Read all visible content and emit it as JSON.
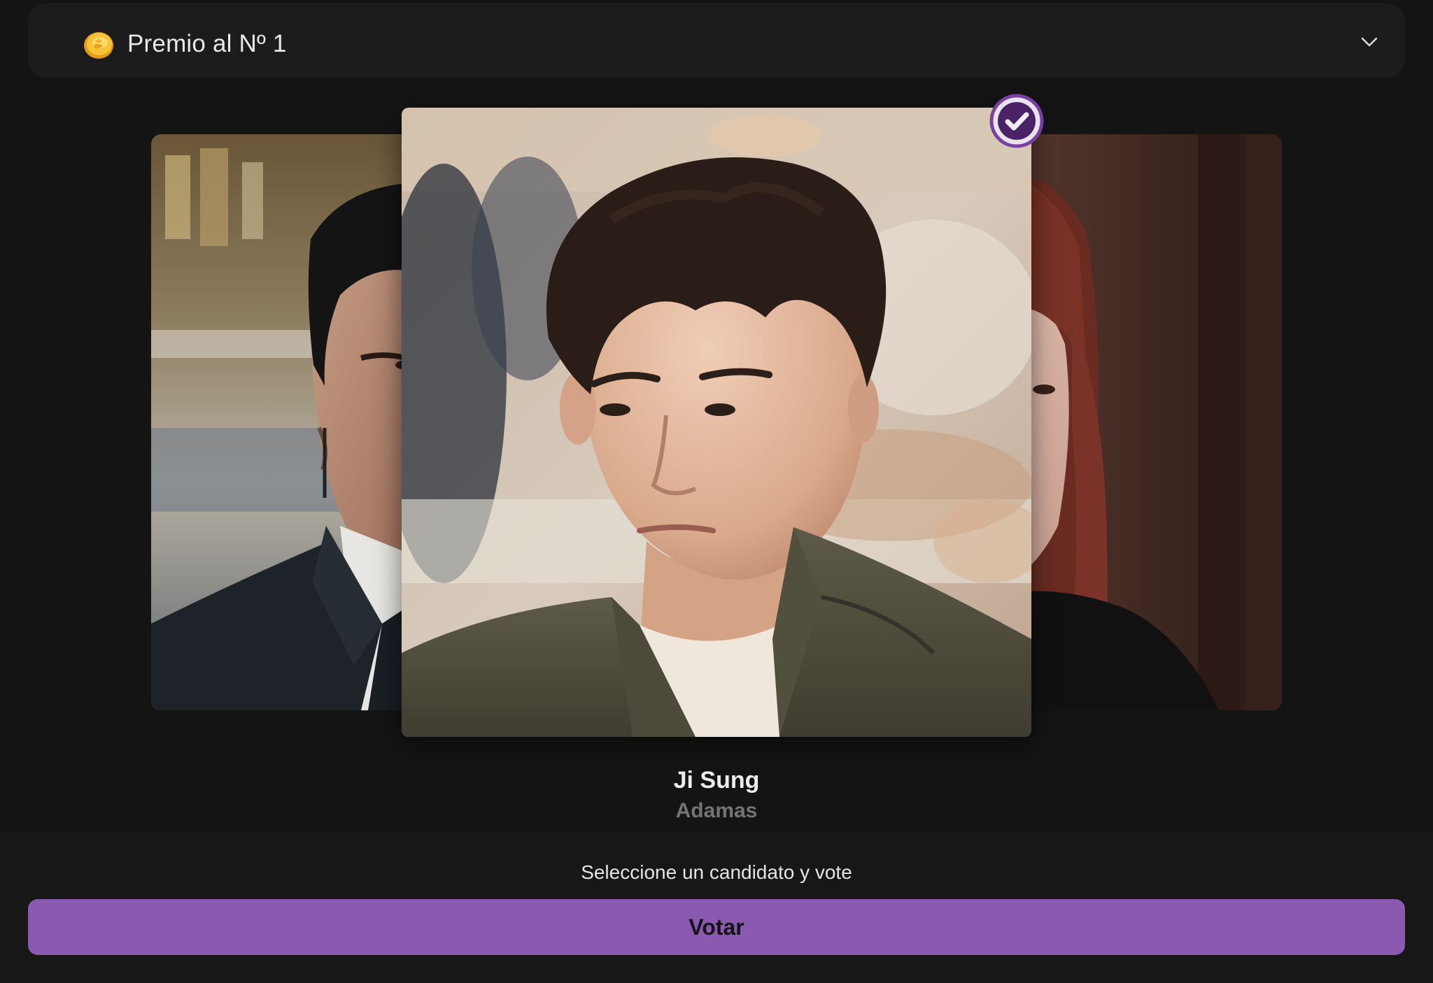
{
  "award": {
    "title": "Premio al Nº 1",
    "icon": "coin-icon",
    "expand_icon": "chevron-down-icon"
  },
  "carousel": {
    "selected_index": 1,
    "cards": [
      {
        "position": "left",
        "photo": "candidate-photo-man-dark-suit"
      },
      {
        "position": "center",
        "photo": "candidate-photo-ji-sung",
        "selected": true
      },
      {
        "position": "right",
        "photo": "candidate-photo-woman-red-hair"
      }
    ]
  },
  "candidate": {
    "name": "Ji Sung",
    "show": "Adamas"
  },
  "footer": {
    "instruction": "Seleccione un candidato y vote",
    "vote_label": "Votar"
  },
  "colors": {
    "background": "#141414",
    "header_bg": "#1c1c1d",
    "accent": "#8a5ab1",
    "check_badge": "#7a3fa2",
    "coin": "#f4b731"
  }
}
